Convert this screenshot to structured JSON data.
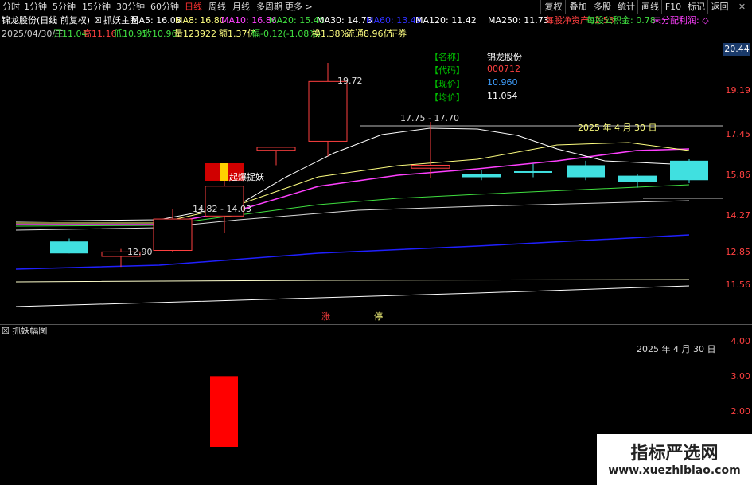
{
  "periods": [
    {
      "label": "分时"
    },
    {
      "label": "1分钟"
    },
    {
      "label": "5分钟"
    },
    {
      "label": "15分钟"
    },
    {
      "label": "30分钟"
    },
    {
      "label": "60分钟"
    },
    {
      "label": "日线"
    },
    {
      "label": "周线"
    },
    {
      "label": "月线"
    },
    {
      "label": "多周期"
    },
    {
      "label": "更多 >"
    }
  ],
  "right_buttons": [
    "复权",
    "叠加",
    "多股",
    "统计",
    "画线",
    "F10",
    "标记",
    "返回"
  ],
  "ma_bar": {
    "stock": "锦龙股份(日线 前复权)",
    "indicator": "抓妖主图",
    "items": [
      {
        "text": "MA5: 16.08",
        "color": "#ffffff"
      },
      {
        "text": "MA8: 16.80",
        "color": "#ffff80"
      },
      {
        "text": "MA10: 16.86",
        "color": "#ff40ff"
      },
      {
        "text": "MA20: 15.40",
        "color": "#40e040"
      },
      {
        "text": "MA30: 14.78",
        "color": "#ffffff"
      },
      {
        "text": "MA60: 13.49",
        "color": "#3030ff"
      },
      {
        "text": "MA120: 11.42",
        "color": "#ffffff"
      },
      {
        "text": "MA250: 11.73",
        "color": "#ffffff"
      },
      {
        "text": "每股净资产: 2.53",
        "color": "#ff4040"
      },
      {
        "text": "每股公积金: 0.78",
        "color": "#40e040"
      },
      {
        "text": "未分配利润: ◇",
        "color": "#ff40ff"
      }
    ]
  },
  "info_line": {
    "date": "2025/04/30/三",
    "open": "开11.04",
    "high": "高11.16",
    "low": "低10.95",
    "close": "收10.96",
    "vol": "量123922",
    "amount": "额1.37亿",
    "change": "幅-0.12(-1.08%)",
    "turnover": "换1.38%",
    "float": "流通8.96亿",
    "sector": "证券"
  },
  "price_tag": "20.44",
  "info_box": {
    "labels": [
      "【名称】",
      "【代码】",
      "【现价】",
      "【均价】"
    ],
    "values": [
      "锦龙股份",
      "000712",
      "10.960",
      "11.054"
    ],
    "value_colors": [
      "#ffffff",
      "#ff4040",
      "#40a0ff",
      "#ffffff"
    ]
  },
  "main_axis": [
    "19.19",
    "17.45",
    "15.86",
    "14.27",
    "12.85",
    "11.56"
  ],
  "sub_axis": [
    "4.00",
    "3.00",
    "2.00"
  ],
  "annotations": {
    "high_label": "19.72",
    "range1": "17.75 - 17.70",
    "range2": "14.82 - 14.03",
    "low_label": "12.90",
    "date_main": "2025 年 4 月 30 日",
    "date_sub": "2025 年 4 月 30 日",
    "signal": "起爆捉妖",
    "zhang": "涨",
    "ting": "停"
  },
  "sub_panel_title": "抓妖幅图",
  "watermark": {
    "title": "指标严选网",
    "url": "www.xuezhibiao.com"
  },
  "chart_data": {
    "type": "candlestick",
    "candles": [
      {
        "o": 13.75,
        "c": 13.35,
        "h": 13.85,
        "l": 13.35
      },
      {
        "o": 13.25,
        "c": 13.4,
        "h": 13.5,
        "l": 12.9
      },
      {
        "o": 13.45,
        "c": 14.5,
        "h": 14.82,
        "l": 13.4
      },
      {
        "o": 14.6,
        "c": 15.6,
        "h": 16.0,
        "l": 14.03
      },
      {
        "o": 16.8,
        "c": 16.9,
        "h": 16.9,
        "l": 16.3
      },
      {
        "o": 17.1,
        "c": 19.1,
        "h": 19.72,
        "l": 16.6
      },
      {
        "o": 16.2,
        "c": 16.3,
        "h": 17.75,
        "l": 15.86
      },
      {
        "o": 16.0,
        "c": 15.9,
        "h": 16.15,
        "l": 15.8
      },
      {
        "o": 16.1,
        "c": 16.05,
        "h": 16.35,
        "l": 15.9
      },
      {
        "o": 16.3,
        "c": 15.9,
        "h": 16.45,
        "l": 15.8
      },
      {
        "o": 15.95,
        "c": 15.75,
        "h": 16.0,
        "l": 15.55
      },
      {
        "o": 16.45,
        "c": 15.8,
        "h": 16.5,
        "l": 15.7
      }
    ],
    "sub_bar": {
      "value": 3.0,
      "ylim": [
        1.0,
        4.0
      ]
    },
    "ylim": [
      10.96,
      20.44
    ]
  }
}
